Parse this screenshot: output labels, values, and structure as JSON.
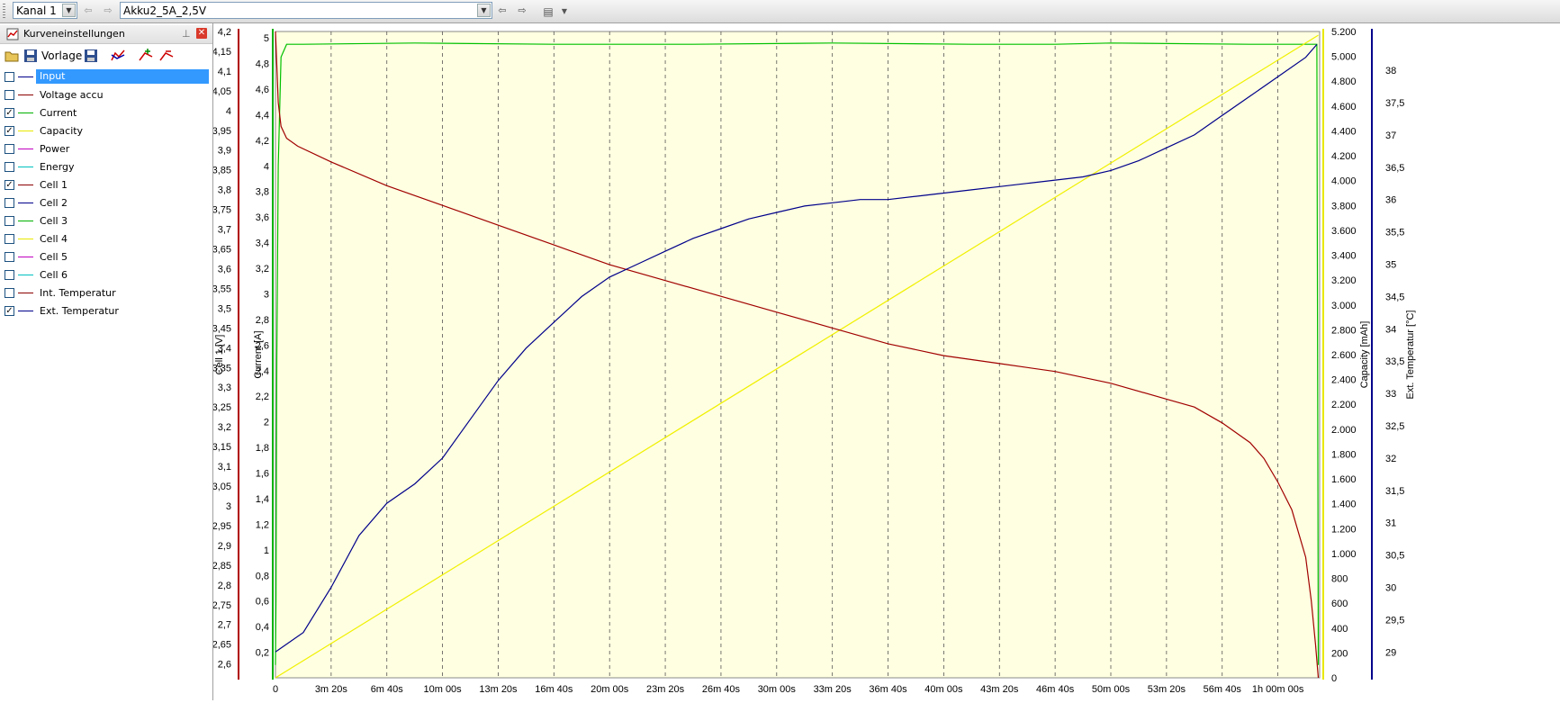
{
  "toolbar": {
    "channel": "Kanal 1",
    "profile": "Akku2_5A_2,5V"
  },
  "panel": {
    "title": "Kurveneinstellungen",
    "template_label": "Vorlage",
    "curves": [
      {
        "label": "Input",
        "checked": false,
        "color": "#00008b",
        "selected": true
      },
      {
        "label": "Voltage accu",
        "checked": false,
        "color": "#8b0000",
        "selected": false
      },
      {
        "label": "Current",
        "checked": true,
        "color": "#00b000",
        "selected": false
      },
      {
        "label": "Capacity",
        "checked": true,
        "color": "#e8e800",
        "selected": false
      },
      {
        "label": "Power",
        "checked": false,
        "color": "#c000c0",
        "selected": false
      },
      {
        "label": "Energy",
        "checked": false,
        "color": "#00c0c0",
        "selected": false
      },
      {
        "label": "Cell 1",
        "checked": true,
        "color": "#8b0000",
        "selected": false
      },
      {
        "label": "Cell 2",
        "checked": false,
        "color": "#00008b",
        "selected": false
      },
      {
        "label": "Cell 3",
        "checked": false,
        "color": "#00b000",
        "selected": false
      },
      {
        "label": "Cell 4",
        "checked": false,
        "color": "#e8e800",
        "selected": false
      },
      {
        "label": "Cell 5",
        "checked": false,
        "color": "#c000c0",
        "selected": false
      },
      {
        "label": "Cell 6",
        "checked": false,
        "color": "#00c0c0",
        "selected": false
      },
      {
        "label": "Int. Temperatur",
        "checked": false,
        "color": "#8b0000",
        "selected": false
      },
      {
        "label": "Ext. Temperatur",
        "checked": true,
        "color": "#00008b",
        "selected": false
      }
    ]
  },
  "chart_data": {
    "type": "line",
    "x_unit": "seconds",
    "xlim": [
      0,
      3750
    ],
    "x_ticks": [
      0,
      200,
      400,
      600,
      800,
      1000,
      1200,
      1400,
      1600,
      1800,
      2000,
      2200,
      2400,
      2600,
      2800,
      3000,
      3200,
      3400,
      3600
    ],
    "x_tick_labels": [
      "0",
      "3m 20s",
      "6m 40s",
      "10m 00s",
      "13m 20s",
      "16m 40s",
      "20m 00s",
      "23m 20s",
      "26m 40s",
      "30m 00s",
      "33m 20s",
      "36m 40s",
      "40m 00s",
      "43m 20s",
      "46m 40s",
      "50m 00s",
      "53m 20s",
      "56m 40s",
      "1h 00m 00s"
    ],
    "axes": [
      {
        "id": "cell1",
        "label": "Cell 1 [V]",
        "side": "left",
        "color": "#b00000",
        "min": 2.565,
        "max": 4.2,
        "ticks": [
          "2,6",
          "2,65",
          "2,7",
          "2,75",
          "2,8",
          "2,85",
          "2,9",
          "2,95",
          "3",
          "3,05",
          "3,1",
          "3,15",
          "3,2",
          "3,25",
          "3,3",
          "3,35",
          "3,4",
          "3,45",
          "3,5",
          "3,55",
          "3,6",
          "3,65",
          "3,7",
          "3,75",
          "3,8",
          "3,85",
          "3,9",
          "3,95",
          "4",
          "4,05",
          "4,1",
          "4,15",
          "4,2"
        ]
      },
      {
        "id": "current",
        "label": "Current [A]",
        "side": "left",
        "color": "#00b000",
        "min": 0,
        "max": 5.05,
        "ticks": [
          "0,2",
          "0,4",
          "0,6",
          "0,8",
          "1",
          "1,2",
          "1,4",
          "1,6",
          "1,8",
          "2",
          "2,2",
          "2,4",
          "2,6",
          "2,8",
          "3",
          "3,2",
          "3,4",
          "3,6",
          "3,8",
          "4",
          "4,2",
          "4,4",
          "4,6",
          "4,8",
          "5"
        ]
      },
      {
        "id": "capacity",
        "label": "Capacity [mAh]",
        "side": "right",
        "color": "#e8e800",
        "min": 0,
        "max": 5200,
        "ticks": [
          "0",
          "200",
          "400",
          "600",
          "800",
          "1.000",
          "1.200",
          "1.400",
          "1.600",
          "1.800",
          "2.000",
          "2.200",
          "2.400",
          "2.600",
          "2.800",
          "3.000",
          "3.200",
          "3.400",
          "3.600",
          "3.800",
          "4.000",
          "4.200",
          "4.400",
          "4.600",
          "4.800",
          "5.000",
          "5.200"
        ]
      },
      {
        "id": "temp",
        "label": "Ext. Temperatur [°C]",
        "side": "right",
        "color": "#00008b",
        "min": 28.6,
        "max": 38.6,
        "ticks": [
          "29",
          "29,5",
          "30",
          "30,5",
          "31",
          "31,5",
          "32",
          "32,5",
          "33",
          "33,5",
          "34",
          "34,5",
          "35",
          "35,5",
          "36",
          "36,5",
          "37",
          "37,5",
          "38"
        ]
      }
    ],
    "series": [
      {
        "name": "Current",
        "axis": "current",
        "color": "#00c000",
        "x": [
          0,
          2,
          5,
          10,
          20,
          40,
          100,
          500,
          1000,
          1500,
          2000,
          2500,
          2800,
          3000,
          3500,
          3740,
          3745
        ],
        "y": [
          0.1,
          0.6,
          2.5,
          4.0,
          4.85,
          4.95,
          4.95,
          4.96,
          4.95,
          4.95,
          4.96,
          4.95,
          4.95,
          4.96,
          4.95,
          4.95,
          0.1
        ]
      },
      {
        "name": "Capacity",
        "axis": "capacity",
        "color": "#f0f000",
        "x": [
          0,
          3745
        ],
        "y": [
          0,
          5170
        ]
      },
      {
        "name": "Cell 1",
        "axis": "cell1",
        "color": "#a00000",
        "x": [
          0,
          3,
          10,
          20,
          40,
          80,
          200,
          400,
          600,
          800,
          1000,
          1200,
          1400,
          1600,
          1800,
          2000,
          2200,
          2400,
          2600,
          2800,
          3000,
          3200,
          3300,
          3400,
          3500,
          3550,
          3600,
          3650,
          3700,
          3720,
          3735,
          3745
        ],
        "y": [
          4.2,
          4.15,
          4.02,
          3.96,
          3.93,
          3.91,
          3.87,
          3.81,
          3.76,
          3.71,
          3.66,
          3.61,
          3.57,
          3.53,
          3.49,
          3.45,
          3.41,
          3.38,
          3.36,
          3.34,
          3.31,
          3.27,
          3.25,
          3.21,
          3.16,
          3.12,
          3.06,
          2.99,
          2.87,
          2.76,
          2.65,
          2.565
        ]
      },
      {
        "name": "Ext. Temperatur",
        "axis": "temp",
        "color": "#00008b",
        "x": [
          0,
          100,
          200,
          300,
          400,
          500,
          600,
          700,
          800,
          900,
          1000,
          1100,
          1200,
          1300,
          1400,
          1500,
          1600,
          1700,
          1800,
          1900,
          2000,
          2100,
          2200,
          2300,
          2400,
          2500,
          2600,
          2700,
          2800,
          2900,
          3000,
          3100,
          3200,
          3300,
          3400,
          3500,
          3600,
          3700,
          3740
        ],
        "y": [
          29.0,
          29.3,
          30.0,
          30.8,
          31.3,
          31.6,
          32.0,
          32.6,
          33.2,
          33.7,
          34.1,
          34.5,
          34.8,
          35.0,
          35.2,
          35.4,
          35.55,
          35.7,
          35.8,
          35.9,
          35.95,
          36.0,
          36.0,
          36.05,
          36.1,
          36.15,
          36.2,
          36.25,
          36.3,
          36.35,
          36.45,
          36.6,
          36.8,
          37.0,
          37.3,
          37.6,
          37.9,
          38.2,
          38.4
        ]
      }
    ]
  }
}
